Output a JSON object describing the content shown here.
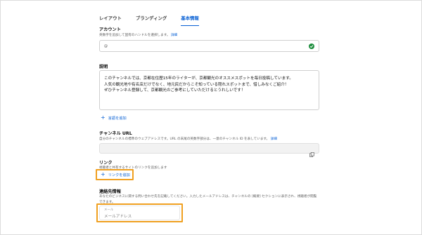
{
  "tabs": [
    {
      "label": "レイアウト"
    },
    {
      "label": "ブランディング"
    },
    {
      "label": "基本情報"
    }
  ],
  "account": {
    "label": "アカウント",
    "hint": "英数字を追加して固有のハンドルを選択します。",
    "hint_link": "詳細",
    "value": "@"
  },
  "description": {
    "label": "説明",
    "lines": [
      "このチャンネルでは、京都在住歴15年のライターが、京都観光のオススメスポットを毎日投稿しています。",
      "人気の観光地や有名店だけでなく、地元民だからこそ知っている隠れスポットまで、惜しみなくご紹介！",
      "ぜひチャンネル登録して、京都観光のご参考にしていただけるとうれしいです！"
    ],
    "add_language": "言語を追加"
  },
  "channel_url": {
    "label": "チャンネル URL",
    "hint": "自分のチャンネルの標準のウェブアドレスです。URL の末尾の英数字部分は、一意のチャンネル ID を表しています。",
    "hint_link": "詳細"
  },
  "links": {
    "label": "リンク",
    "hint": "視聴者と共有するサイトのリンクを追加します",
    "add_link": "リンクを追加"
  },
  "contact": {
    "label": "連絡先情報",
    "hint_line1": "あなたのビジネスに関する問い合わせ先を記載してください。入力したメールアドレスは、チャンネルの [概要] セクションに表示され、視聴者が閲覧",
    "hint_line2": "できます。",
    "email_caption": "メール",
    "email_placeholder": "メールアドレス"
  },
  "colors": {
    "accent": "#065fd4",
    "highlight": "#f0a020",
    "verified": "#1e8e3e"
  }
}
